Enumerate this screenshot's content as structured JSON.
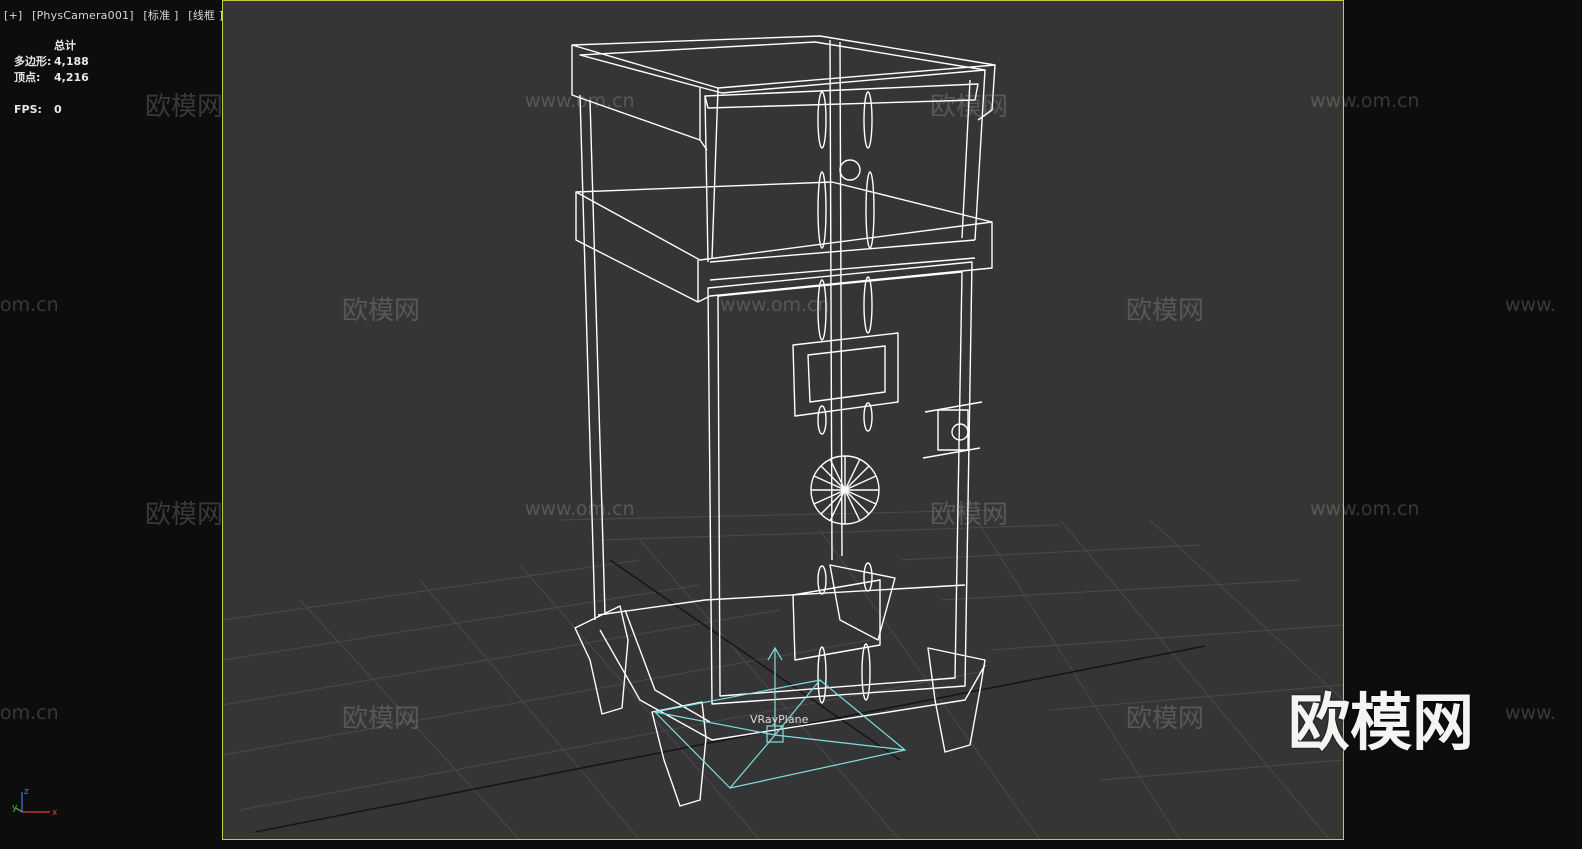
{
  "viewport": {
    "plus": "[+]",
    "camera": "[PhysCamera001]",
    "shading": "[标准 ]",
    "mode": "[线框 ]"
  },
  "stats": {
    "header": "总计",
    "polygons_label": "多边形:",
    "polygons_value": "4,188",
    "vertices_label": "顶点:",
    "vertices_value": "4,216",
    "fps_label": "FPS:",
    "fps_value": "0"
  },
  "scene": {
    "object_label": "VRayPlane",
    "wire_color": "#ffffff",
    "helper_color": "#7fe0e0",
    "grid_color": "#4a4a4a",
    "frame_color": "#c9c943"
  },
  "watermarks": {
    "cn": "欧模网",
    "url": "www.om.cn",
    "url_partial_left": "om.cn",
    "url_partial_right": "www.",
    "big": "欧模网"
  },
  "axis": {
    "x": "x",
    "y": "y",
    "z": "z"
  }
}
